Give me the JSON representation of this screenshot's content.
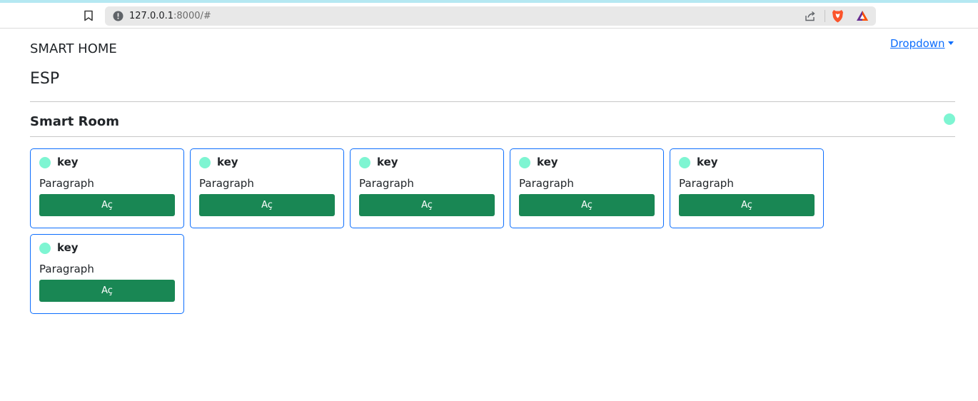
{
  "browser": {
    "url_host": "127.0.0.1",
    "url_path": ":8000/#",
    "icons": [
      "bookmark-icon",
      "info-icon",
      "share-icon",
      "brave-shields-icon",
      "brave-rewards-icon"
    ]
  },
  "navbar": {
    "brand": "SMART HOME",
    "dropdown_label": "Dropdown"
  },
  "page": {
    "title": "ESP",
    "section_title": "Smart Room"
  },
  "colors": {
    "accent": "#0d6efd",
    "button": "#198754",
    "status_dot": "#7ef5d2"
  },
  "cards": [
    {
      "key": "key",
      "paragraph": "Paragraph",
      "button": "Aç"
    },
    {
      "key": "key",
      "paragraph": "Paragraph",
      "button": "Aç"
    },
    {
      "key": "key",
      "paragraph": "Paragraph",
      "button": "Aç"
    },
    {
      "key": "key",
      "paragraph": "Paragraph",
      "button": "Aç"
    },
    {
      "key": "key",
      "paragraph": "Paragraph",
      "button": "Aç"
    },
    {
      "key": "key",
      "paragraph": "Paragraph",
      "button": "Aç"
    }
  ]
}
